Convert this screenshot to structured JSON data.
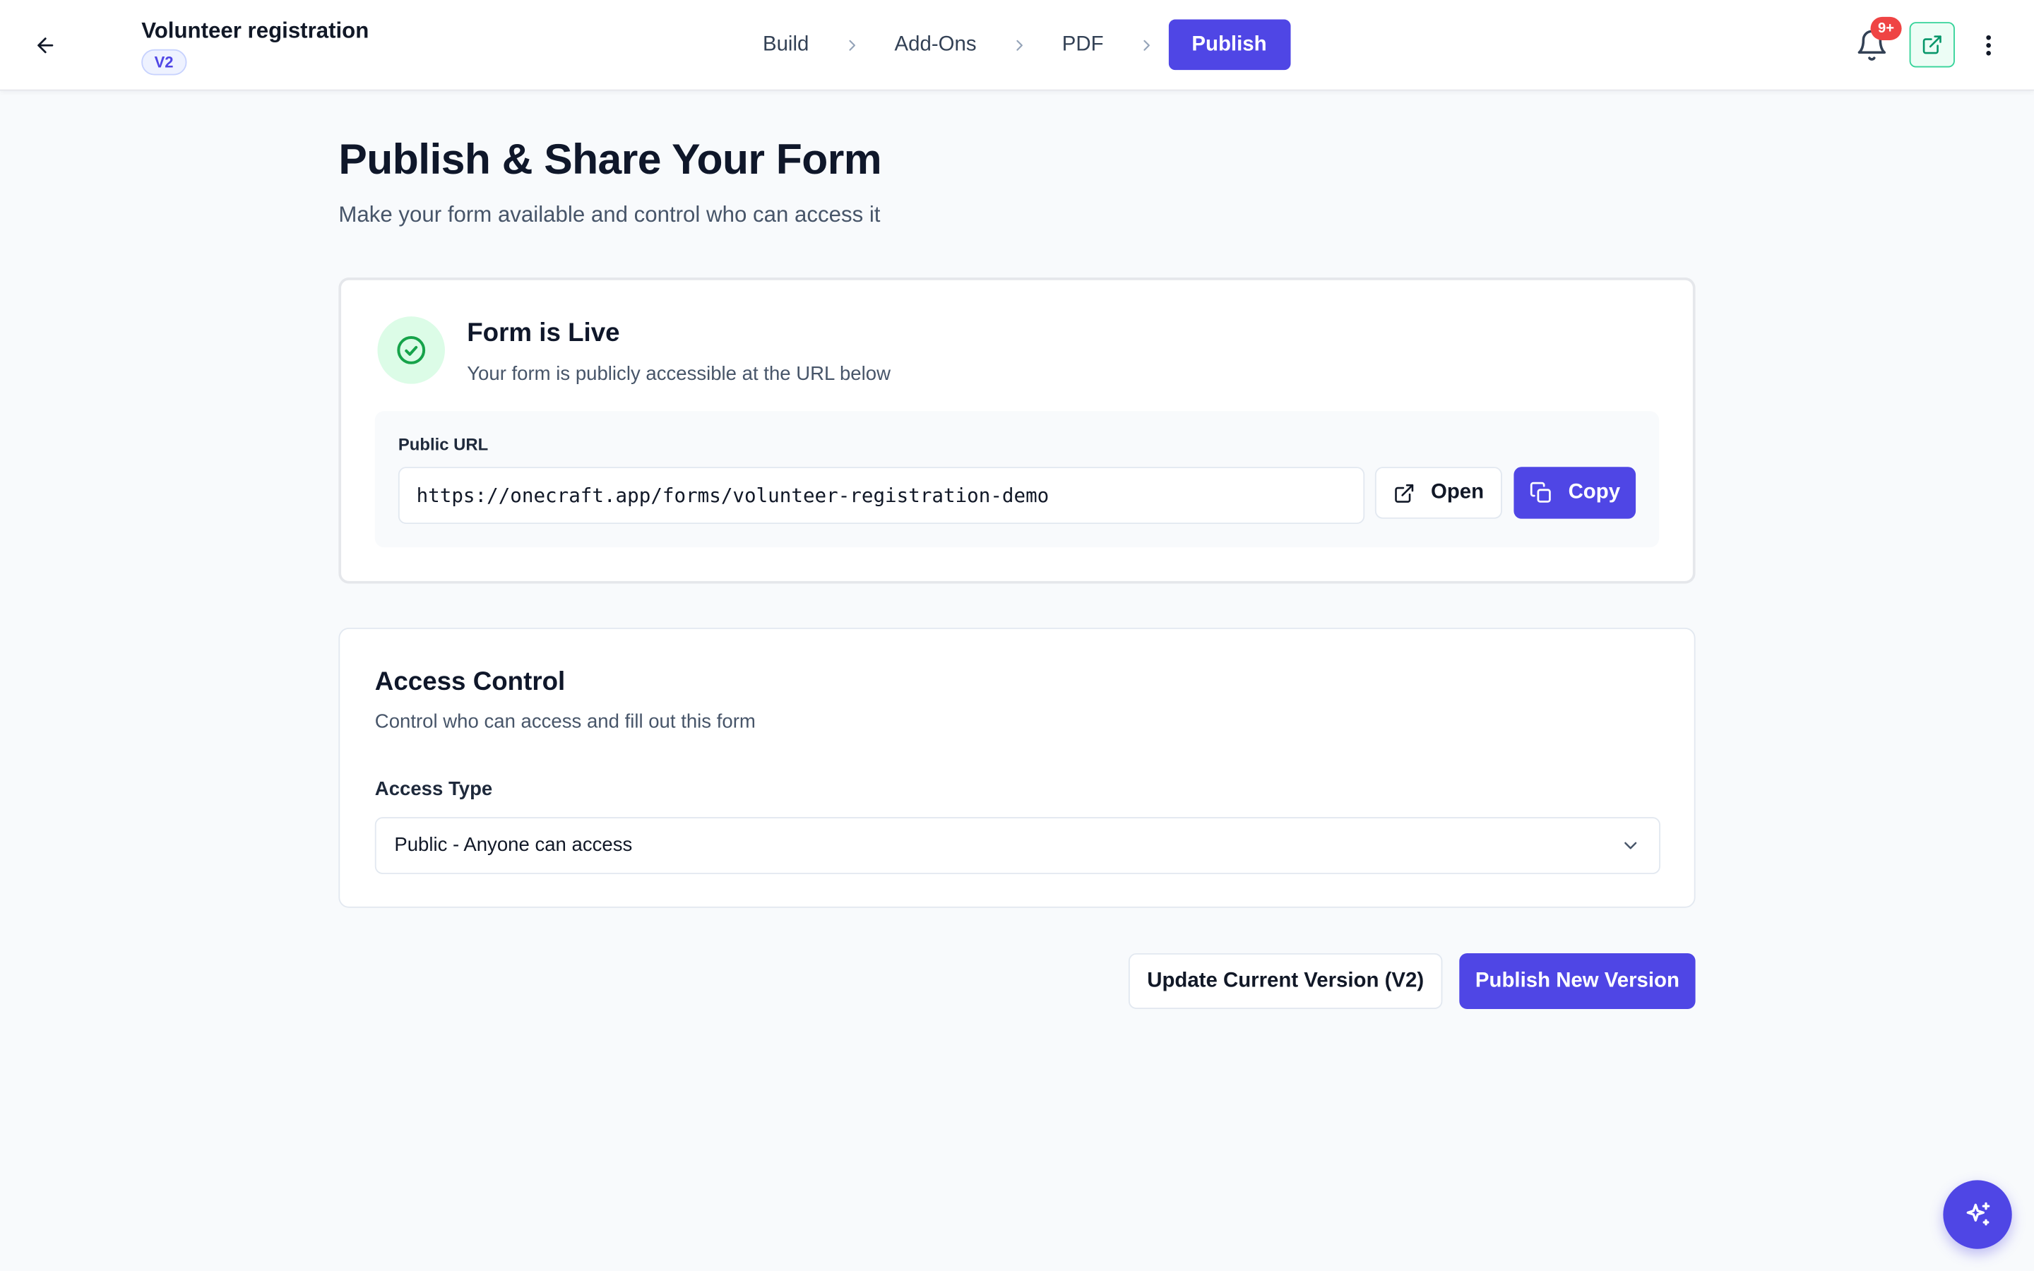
{
  "header": {
    "form_title": "Volunteer registration",
    "version_badge": "V2",
    "steps": [
      {
        "label": "Build"
      },
      {
        "label": "Add-Ons"
      },
      {
        "label": "PDF"
      },
      {
        "label": "Publish",
        "active": true
      }
    ],
    "notification_count": "9+",
    "icons": [
      "back-arrow-icon",
      "chevron-right-icon",
      "bell-icon",
      "external-link-icon",
      "more-vertical-icon"
    ]
  },
  "main": {
    "title": "Publish & Share Your Form",
    "subtitle": "Make your form available and control who can access it"
  },
  "live_card": {
    "title": "Form is Live",
    "subtitle": "Your form is publicly accessible at the URL below",
    "url_label": "Public URL",
    "url_value": "https://onecraft.app/forms/volunteer-registration-demo",
    "open_label": "Open",
    "copy_label": "Copy"
  },
  "access_card": {
    "title": "Access Control",
    "subtitle": "Control who can access and fill out this form",
    "type_label": "Access Type",
    "selected_option": "Public - Anyone can access"
  },
  "actions": {
    "update_label": "Update Current Version (V2)",
    "publish_label": "Publish New Version"
  },
  "colors": {
    "accent": "#4f46e5",
    "success": "#16a34a",
    "success_bg": "#dcfce7",
    "danger": "#ef4444"
  }
}
